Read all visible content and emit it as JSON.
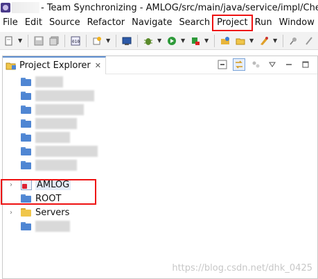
{
  "window": {
    "title": "- Team Synchronizing - AMLOG/src/main/java/service/impl/CheckLog"
  },
  "menu": {
    "items": [
      {
        "label": "File"
      },
      {
        "label": "Edit"
      },
      {
        "label": "Source"
      },
      {
        "label": "Refactor"
      },
      {
        "label": "Navigate"
      },
      {
        "label": "Search"
      },
      {
        "label": "Project",
        "highlighted": true
      },
      {
        "label": "Run"
      },
      {
        "label": "Window"
      }
    ]
  },
  "toolbar": {
    "icons": [
      "new-icon",
      "save-icon",
      "save-all-icon",
      "binary-icon",
      "new-class-icon",
      "console-icon",
      "debug-icon",
      "run-icon",
      "external-tools-icon",
      "open-type-icon",
      "open-folder-icon",
      "search-icon",
      "pin-icon"
    ]
  },
  "explorer": {
    "title": "Project Explorer",
    "close_glyph": "✕",
    "tree": [
      {
        "label": "",
        "blurred": true,
        "icon": "folder-icon"
      },
      {
        "label": "",
        "blurred": true,
        "icon": "folder-icon"
      },
      {
        "label": "",
        "blurred": true,
        "icon": "folder-icon"
      },
      {
        "label": "",
        "blurred": true,
        "icon": "folder-icon"
      },
      {
        "label": "",
        "blurred": true,
        "icon": "folder-icon"
      },
      {
        "label": "",
        "blurred": true,
        "icon": "folder-icon"
      },
      {
        "label": "",
        "blurred": true,
        "icon": "folder-icon"
      },
      {
        "label": "AMLOG",
        "icon": "project-icon",
        "expandable": true,
        "selected": true
      },
      {
        "label": "ROOT",
        "icon": "folder-icon"
      },
      {
        "label": "Servers",
        "icon": "folder-open-icon",
        "expandable": true
      },
      {
        "label": "",
        "blurred": true,
        "icon": "folder-icon"
      }
    ]
  },
  "watermark": "https://blog.csdn.net/dhk_0425",
  "colors": {
    "highlight_box": "#ee1111",
    "tab_accent": "#5f8fd0"
  }
}
